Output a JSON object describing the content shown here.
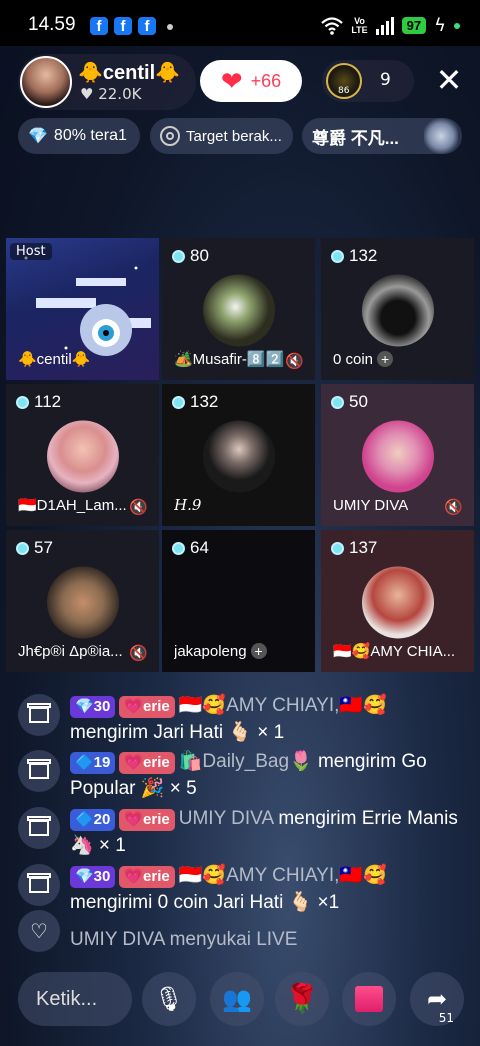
{
  "status_bar": {
    "time": "14.59",
    "fb": "f",
    "volte_top": "Vo",
    "volte_bottom": "LTE",
    "battery": "97"
  },
  "header": {
    "host_name": "🐥centil🐥",
    "host_likes": "♥ 22.0K",
    "like_count": "+66",
    "viewer_badge": "86",
    "viewer_count": "9",
    "close": "✕"
  },
  "chips": [
    {
      "label": "80% tera1"
    },
    {
      "label": "Target berak..."
    },
    {
      "label": "尊爵 不凡..."
    }
  ],
  "grid": {
    "host_tag": "Host",
    "host_name": "🐥centil🐥",
    "tiles": [
      {
        "score": "80",
        "name": "🏕️Musafir-8️⃣2️⃣"
      },
      {
        "score": "132",
        "name": "0 coin"
      },
      {
        "score": "112",
        "name": "🇮🇩D1AH_Lam..."
      },
      {
        "score": "132",
        "name": "H.9"
      },
      {
        "score": "50",
        "name": "UMIY DIVA"
      },
      {
        "score": "57",
        "name": "Jh€p®i Δp®ia..."
      },
      {
        "score": "64",
        "name": "jakapoleng"
      },
      {
        "score": "137",
        "name": "🇮🇩🥰AMY CHIA..."
      }
    ],
    "plus": "+"
  },
  "feed": [
    {
      "level": "💎30",
      "fan": "💗erie",
      "user": "🇮🇩🥰AMY CHIAYI,🇹🇼🥰",
      "text": "mengirim Jari Hati 🫰🏻 × 1"
    },
    {
      "level": "🔷19",
      "fan": "💗erie",
      "user": "🛍️Daily_Bag🌷",
      "text": "mengirim Go Popular 🎉 × 5"
    },
    {
      "level": "🔷20",
      "fan": "💗erie",
      "user": "UMIY DIVA",
      "text": "mengirim Errie Manis 🦄 × 1"
    },
    {
      "level": "💎30",
      "fan": "💗erie",
      "user": "🇮🇩🥰AMY CHIAYI,🇹🇼🥰",
      "text": "mengirimi 0 coin Jari Hati 🫰🏻 ×1"
    },
    {
      "user": "UMIY DIVA",
      "text": "menyukai LIVE"
    }
  ],
  "bottom": {
    "input_placeholder": "Ketik...",
    "mic": "🎙",
    "people": "👥",
    "rose": "🌹",
    "share_count": "51"
  }
}
